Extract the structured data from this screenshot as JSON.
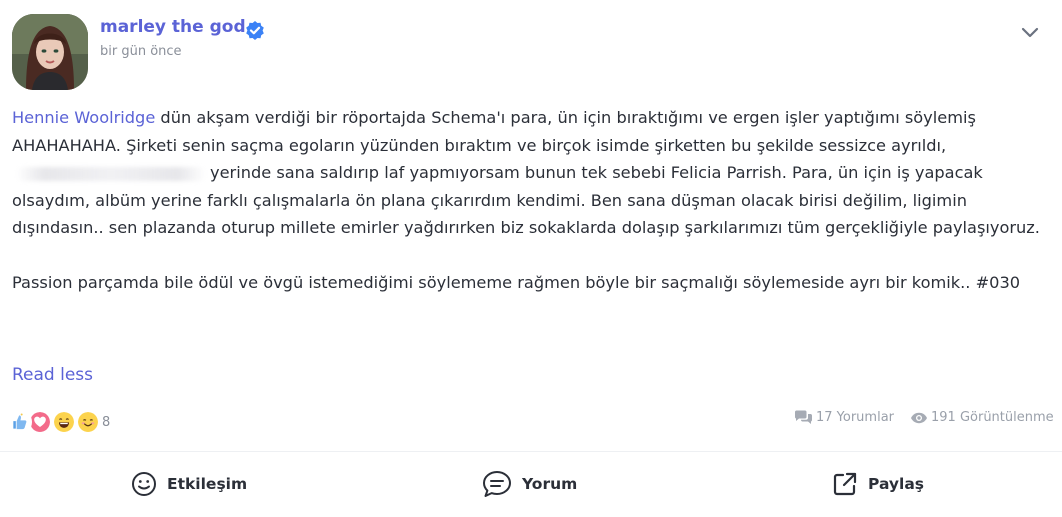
{
  "post": {
    "author": "marley the god",
    "timestamp": "bir gün önce",
    "mention": "Hennie Woolridge",
    "body_line1_rest": " dün akşam verdiği bir röportajda Schema'ı para, ün için bıraktığımı ve ergen işler yaptığımı söylemiş AHAHAHAHA. Şirketi senin saçma egoların yüzünden bıraktım ve birçok isimde şirketten bu şekilde sessizce ayrıldı,",
    "body_after_blur": "yerinde sana saldırıp laf yapmıyorsam bunun tek sebebi Felicia Parrish. Para, ün için iş yapacak olsaydım, albüm yerine farklı çalışmalarla ön plana çıkarırdım kendimi. Ben sana düşman olacak birisi değilim, ligimin dışındasın.. sen plazanda oturup millete emirler yağdırırken biz sokaklarda dolaşıp şarkılarımızı tüm gerçekliğiyle paylaşıyoruz.",
    "paragraph2": "Passion parçamda bile ödül ve övgü istemediğimi söylememe rağmen böyle bir saçmalığı söylemeside ayrı bir komik.. #030",
    "read_less_label": "Read less"
  },
  "reactions": {
    "icons": [
      "thumbs-up-icon",
      "heart-icon",
      "laughing-face-icon",
      "smiling-face-icon"
    ],
    "count": "8"
  },
  "stats": {
    "comments": "17 Yorumlar",
    "views": "191 Görüntülenme"
  },
  "actions": {
    "react_label": "Etkileşim",
    "comment_label": "Yorum",
    "share_label": "Paylaş"
  },
  "colors": {
    "accent": "#5b63d6",
    "verified_badge": "#3b82f6",
    "muted": "#8a8f99"
  }
}
